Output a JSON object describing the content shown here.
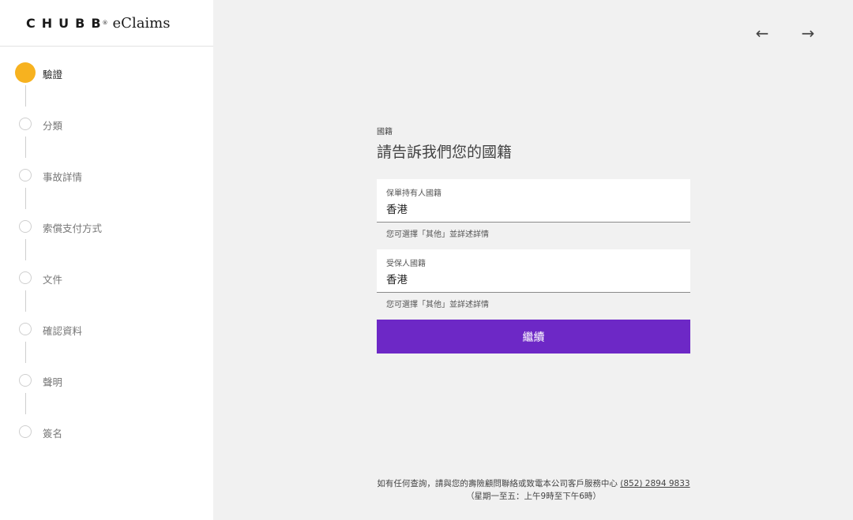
{
  "brand": {
    "logo_text": "CHUBB",
    "registered_mark": "®",
    "product_name": "eClaims"
  },
  "steps": [
    {
      "label": "驗證",
      "active": true
    },
    {
      "label": "分類",
      "active": false
    },
    {
      "label": "事故詳情",
      "active": false
    },
    {
      "label": "索償支付方式",
      "active": false
    },
    {
      "label": "文件",
      "active": false
    },
    {
      "label": "確認資料",
      "active": false
    },
    {
      "label": "聲明",
      "active": false
    },
    {
      "label": "簽名",
      "active": false
    }
  ],
  "nav": {
    "back_icon": "←",
    "forward_icon": "→"
  },
  "form": {
    "eyebrow": "國籍",
    "heading": "請告訴我們您的國籍",
    "policy_holder": {
      "label": "保單持有人國籍",
      "value": "香港",
      "hint": "您可選擇「其他」並詳述詳情"
    },
    "insured": {
      "label": "受保人國籍",
      "value": "香港",
      "hint": "您可選擇「其他」並詳述詳情"
    },
    "continue_label": "繼續"
  },
  "footer": {
    "line1_text": "如有任何查詢，請與您的壽險顧問聯絡或致電本公司客戶服務中心",
    "phone": "(852) 2894 9833",
    "line2_text": "（星期一至五：上午9時至下午6時）"
  },
  "colors": {
    "accent": "#6d28c6",
    "active_step": "#f7b21f"
  }
}
